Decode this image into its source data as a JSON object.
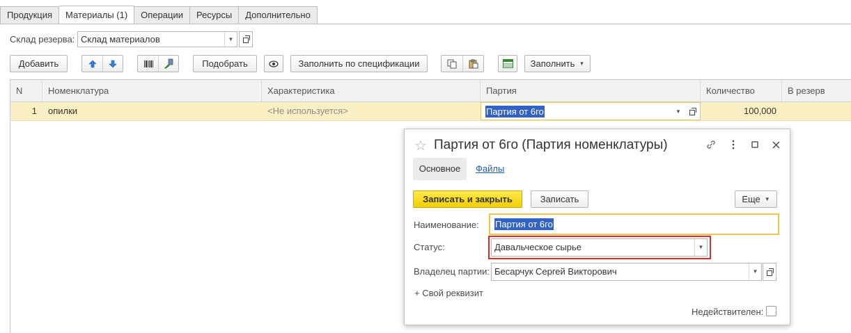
{
  "tabs": [
    {
      "label": "Продукция",
      "active": false
    },
    {
      "label": "Материалы (1)",
      "active": true
    },
    {
      "label": "Операции",
      "active": false
    },
    {
      "label": "Ресурсы",
      "active": false
    },
    {
      "label": "Дополнительно",
      "active": false
    }
  ],
  "reserve": {
    "label": "Склад резерва:",
    "value": "Склад материалов"
  },
  "toolbar": {
    "add": "Добавить",
    "pick": "Подобрать",
    "fill_by_spec": "Заполнить по спецификации",
    "fill": "Заполнить"
  },
  "table": {
    "columns": [
      "N",
      "Номенклатура",
      "Характеристика",
      "Партия",
      "Количество",
      "В резерв"
    ],
    "rows": [
      {
        "n": "1",
        "nomenclature": "опилки",
        "characteristic": "<Не используется>",
        "batch": "Партия от 6го",
        "quantity": "100,000",
        "reserve": ""
      }
    ]
  },
  "dialog": {
    "title": "Партия от 6го (Партия номенклатуры)",
    "tab_main": "Основное",
    "tab_files": "Файлы",
    "save_close": "Записать и закрыть",
    "save": "Записать",
    "more": "Еще",
    "name_label": "Наименование:",
    "name_value": "Партия от 6го",
    "status_label": "Статус:",
    "status_value": "Давальческое сырье",
    "owner_label": "Владелец партии:",
    "owner_value": "Бесарчук Сергей Викторович",
    "custom_attr": "+ Свой реквизит",
    "invalid_label": "Недействителен:",
    "invalid_checked": false
  },
  "colors": {
    "row_highlight": "#fbefc4",
    "selection": "#3262c5",
    "primary_button": "#f2cf00",
    "status_frame": "#e0292a",
    "link": "#1d5bb8"
  }
}
